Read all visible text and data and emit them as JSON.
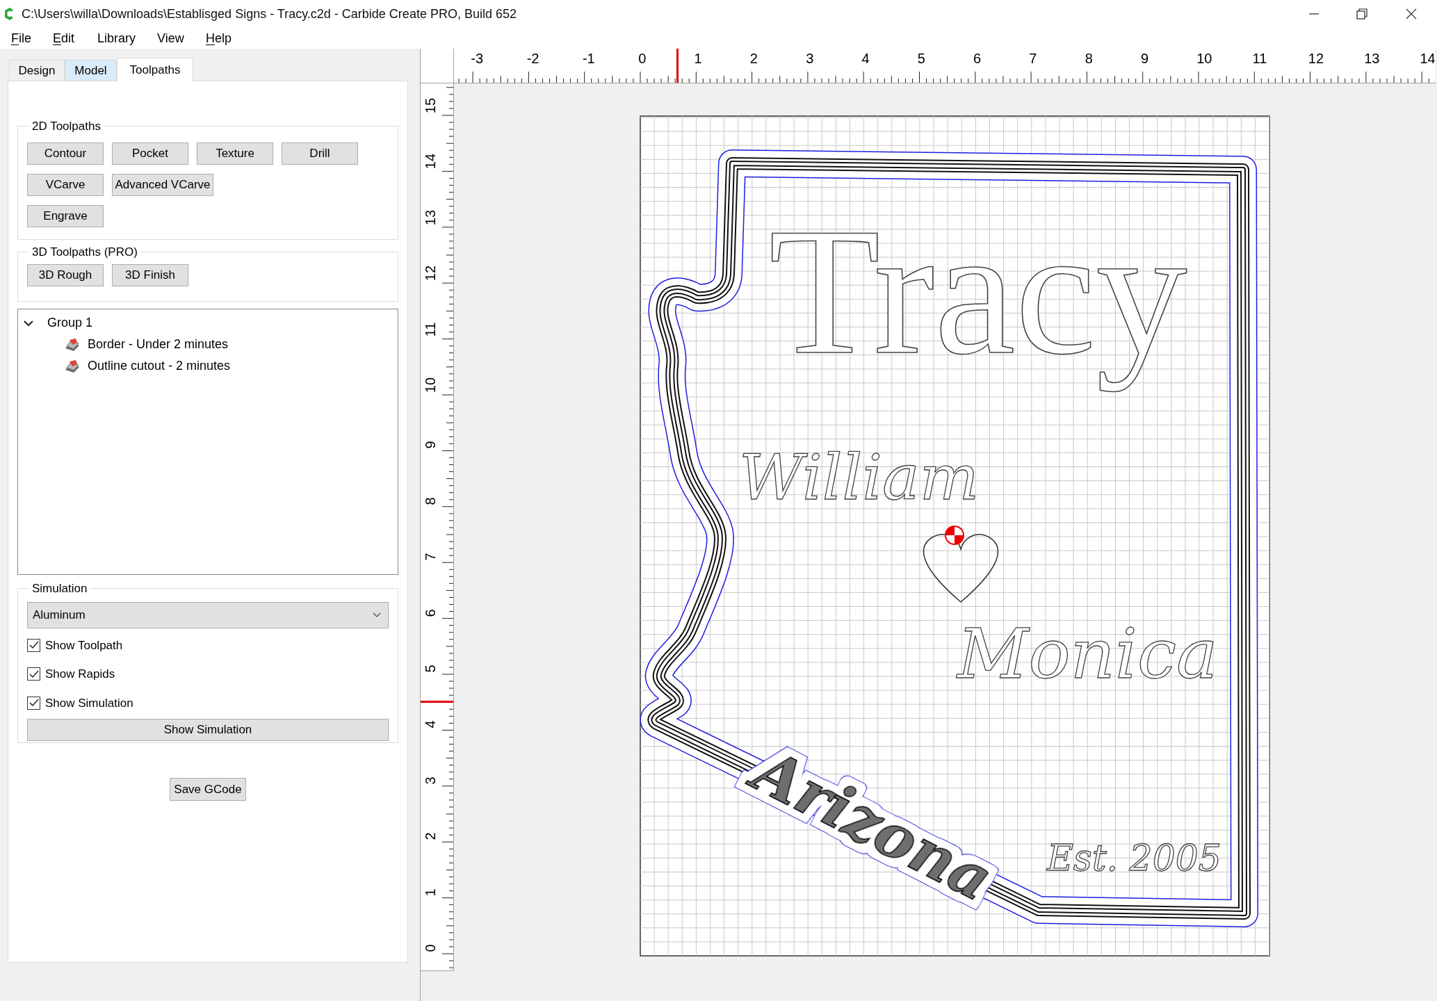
{
  "window": {
    "title": "C:\\Users\\willa\\Downloads\\Establisged Signs - Tracy.c2d - Carbide Create PRO, Build 652"
  },
  "menu": [
    {
      "label": "File",
      "mnemonic": true
    },
    {
      "label": "Edit",
      "mnemonic": true
    },
    {
      "label": "Library",
      "mnemonic": false
    },
    {
      "label": "View",
      "mnemonic": false
    },
    {
      "label": "Help",
      "mnemonic": true
    }
  ],
  "tabs": [
    {
      "label": "Design",
      "selected": false,
      "hovered": false
    },
    {
      "label": "Model",
      "selected": false,
      "hovered": true
    },
    {
      "label": "Toolpaths",
      "selected": true,
      "hovered": false
    }
  ],
  "toolpaths_2d": {
    "title": "2D Toolpaths",
    "buttons": [
      "Contour",
      "Pocket",
      "Texture",
      "Drill",
      "VCarve",
      "Advanced VCarve",
      "Engrave"
    ]
  },
  "toolpaths_3d": {
    "title": "3D Toolpaths (PRO)",
    "buttons": [
      "3D Rough",
      "3D Finish"
    ]
  },
  "toolpath_tree": [
    {
      "label": "Group 1",
      "expanded": true,
      "children": [
        {
          "label": "Border - Under 2 minutes"
        },
        {
          "label": "Outline cutout - 2 minutes"
        }
      ]
    }
  ],
  "simulation": {
    "title": "Simulation",
    "material": {
      "value": "Aluminum"
    },
    "checkboxes": [
      {
        "label": "Show Toolpath",
        "checked": true
      },
      {
        "label": "Show Rapids",
        "checked": true
      },
      {
        "label": "Show Simulation",
        "checked": true
      }
    ],
    "button": "Show Simulation"
  },
  "save_button": "Save GCode",
  "rulers": {
    "horizontal": [
      "-3",
      "-2",
      "-1",
      "0",
      "1",
      "2",
      "3",
      "4",
      "5",
      "6",
      "7",
      "8",
      "9",
      "10",
      "11",
      "12",
      "13",
      "14"
    ],
    "vertical": [
      "0",
      "1",
      "2",
      "3",
      "4",
      "5",
      "6",
      "7",
      "8",
      "9",
      "10",
      "11",
      "12",
      "13",
      "14",
      "15"
    ]
  },
  "canvas": {
    "texts": [
      {
        "kind": "block",
        "text": "Tracy"
      },
      {
        "kind": "script",
        "text": "William"
      },
      {
        "kind": "script",
        "text": "Monica"
      },
      {
        "kind": "cut",
        "text": "Arizona"
      },
      {
        "kind": "script",
        "text": "Est. 2005"
      }
    ]
  }
}
